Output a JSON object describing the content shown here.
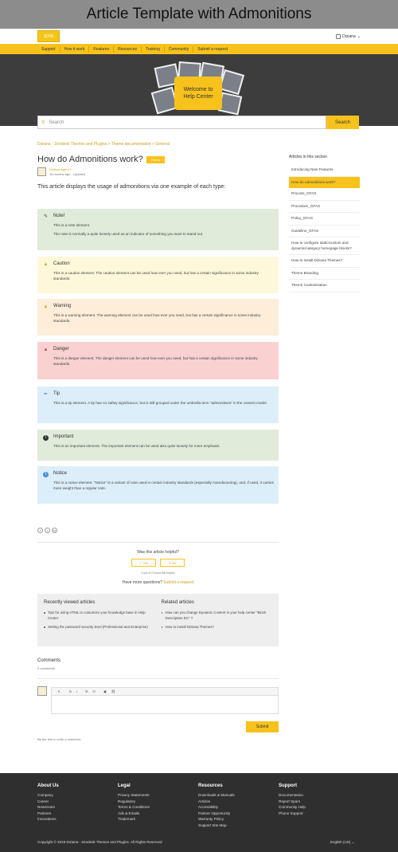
{
  "banner": "Article Template with Admonitions",
  "logo": "JOVE",
  "user": "Diziana",
  "nav": [
    "Support",
    "How it work",
    "Features",
    "Resources",
    "Training",
    "Community",
    "Submit a request"
  ],
  "hero": {
    "line1": "Welcome to",
    "line2": "Help Center"
  },
  "search": {
    "placeholder": "Search",
    "button": "Search"
  },
  "breadcrumb": "Diziana - Zendesk Themes and Plugins  >  Theme documentation  >  General",
  "article": {
    "title": "How do Admonitions work?",
    "follow": "Follow",
    "author": "Diziana Agent 1",
    "meta": "16 months ago · Updated",
    "intro": "This article displays the usage of admonitions via one example of each type:"
  },
  "admonitions": {
    "note": {
      "title": "Note!",
      "p1": "This is a note element.",
      "p2": "The note is normally a quite loosely used as an indicator of something you want to stand out."
    },
    "caution": {
      "title": "Caution",
      "p1": "This is a caution element. The caution element can be used how ever you need, but has a certain significance in some industry standards."
    },
    "warning": {
      "title": "Warning",
      "p1": "This is a warning element. The warning element can be used how ever you need, but has a certain significance in some industry standards."
    },
    "danger": {
      "title": "Danger",
      "p1": "This is a danger element. The danger element can be used how ever you need, but has a certain significance in some industry standards."
    },
    "tip": {
      "title": "Tip",
      "p1": "This is a tip element. A tip has no safety significance, but is still grouped under the umbrella term \"admonitions\" in the content model."
    },
    "important": {
      "title": "Important",
      "p1": "This is an important element. The important element can be used also quite loosely for more emphasis."
    },
    "notice": {
      "title": "Notice",
      "p1": "This is a notice element. \"Notice\" is a variant of note used in certain industry standards (especially manufacturing), and, if used, it carries more weight than a regular note."
    }
  },
  "helpful": {
    "question": "Was this article helpful?",
    "yes": "✓  Yes",
    "no": "✕  No",
    "found": "0 out of 0 found this helpful",
    "more": "Have more questions?",
    "submit_link": "Submit a request"
  },
  "recent": {
    "title": "Recently viewed articles",
    "items": [
      "Tips for using HTML to customize your knowledge base in Help Center",
      "Setting the password security level (Professional and Enterprise)"
    ]
  },
  "related": {
    "title": "Related articles",
    "items": [
      "How can you change Dynamic Content in your help center \"Block Description DC\" ?",
      "How to install Diziana Themes?"
    ]
  },
  "comments": {
    "title": "Comments",
    "count": "0 comments",
    "submit": "Submit",
    "first": "Be the first to write a comment."
  },
  "sidebar": {
    "title": "Articles in this section",
    "items": [
      "Introducing New Features",
      "How do Admonitions work?",
      "Process_GFAS",
      "Procedure_GFAS",
      "Policy_GFAS",
      "Guideline_GFAS",
      "How to configure static/custom and dynamic/category homepage blocks?",
      "How to install Diziana Themes?",
      "Theme Branding",
      "Theme Customization"
    ]
  },
  "footer": {
    "about": {
      "title": "About Us",
      "items": [
        "Company",
        "Career",
        "Newsroom",
        "Partners",
        "Innovations"
      ]
    },
    "legal": {
      "title": "Legal",
      "items": [
        "Privacy Statements",
        "Regulatory",
        "Terms & Conditions",
        "Ads & Emails",
        "Trademark"
      ]
    },
    "resources": {
      "title": "Resources",
      "items": [
        "Downloads & Manuals",
        "Articles",
        "Accessibility",
        "Partner Opportunity",
        "Warranty Policy",
        "Support Site Map"
      ]
    },
    "support": {
      "title": "Support",
      "items": [
        "Documentation",
        "Report Spam",
        "Community Help",
        "Phone Support"
      ]
    },
    "copyright": "Copyright © 2019 Diziana - Zendesk Themes and Plugins. All Rights Reserved",
    "language": "English (US)  ⌄"
  },
  "colors": {
    "accent": "#f7c21c",
    "note": "#e0ebd9",
    "caution": "#fdf8d9",
    "warning": "#fdedd9",
    "danger": "#f9d1d1",
    "tip": "#dceef9"
  }
}
